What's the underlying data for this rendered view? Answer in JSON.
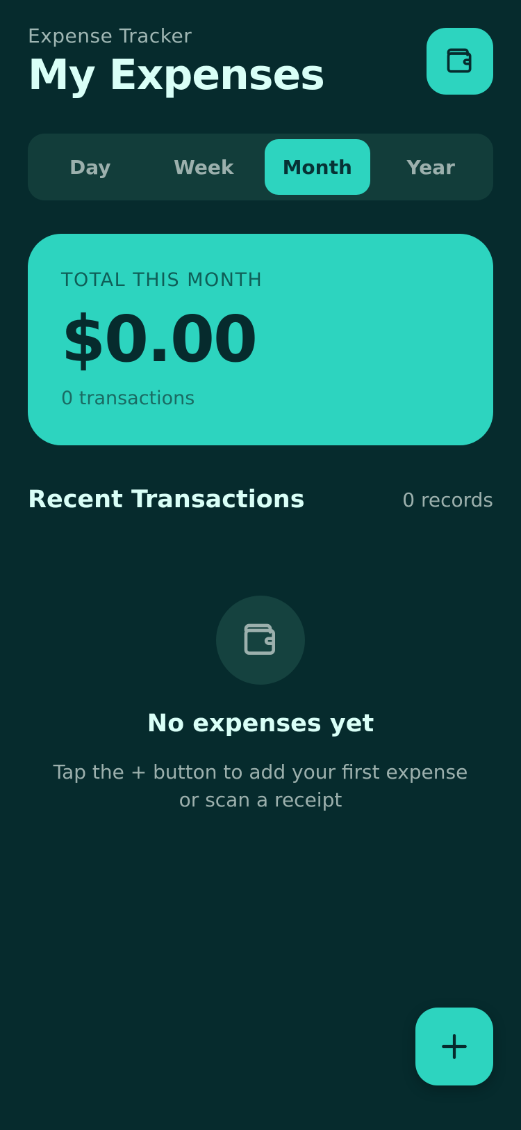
{
  "header": {
    "subtitle": "Expense Tracker",
    "title": "My Expenses",
    "action_icon": "wallet-icon"
  },
  "period_tabs": {
    "items": [
      {
        "label": "Day",
        "active": false
      },
      {
        "label": "Week",
        "active": false
      },
      {
        "label": "Month",
        "active": true
      },
      {
        "label": "Year",
        "active": false
      }
    ]
  },
  "summary": {
    "label": "TOTAL THIS MONTH",
    "amount": "$0.00",
    "count": "0 transactions"
  },
  "recent": {
    "title": "Recent Transactions",
    "count": "0 records"
  },
  "empty_state": {
    "icon": "wallet-icon",
    "title": "No expenses yet",
    "description": "Tap the + button to add your first expense or scan a receipt"
  },
  "fab": {
    "icon": "plus-icon"
  },
  "colors": {
    "background": "#062b2d",
    "accent": "#2dd4bf",
    "segment_bg": "#123d3a",
    "muted_text": "#9cb0ad",
    "heading_text": "#d9fff7"
  }
}
